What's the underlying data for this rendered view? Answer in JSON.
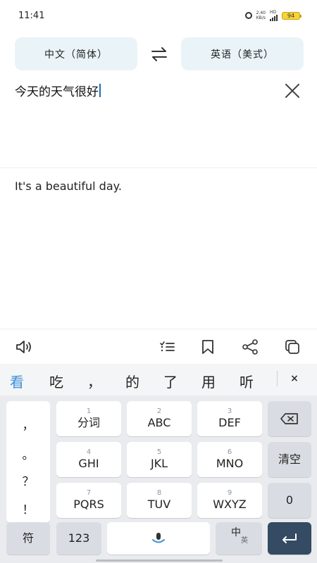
{
  "status": {
    "time": "11:41",
    "net_speed_value": "2.40",
    "net_speed_unit": "KB/s",
    "hd": "HD",
    "battery": "94"
  },
  "languages": {
    "source": "中文（简体）",
    "target": "英语（美式）"
  },
  "input": {
    "source_text": "今天的天气很好"
  },
  "result": {
    "translated_text": "It's a beautiful day."
  },
  "candidates": [
    "看",
    "吃",
    "，",
    "的",
    "了",
    "用",
    "听"
  ],
  "candidates_close": "×",
  "keyboard": {
    "punctuation": [
      "，",
      "。",
      "？",
      "！"
    ],
    "keys": [
      {
        "num": "1",
        "label": "分词"
      },
      {
        "num": "2",
        "label": "ABC"
      },
      {
        "num": "3",
        "label": "DEF"
      },
      {
        "num": "4",
        "label": "GHI"
      },
      {
        "num": "5",
        "label": "JKL"
      },
      {
        "num": "6",
        "label": "MNO"
      },
      {
        "num": "7",
        "label": "PQRS"
      },
      {
        "num": "8",
        "label": "TUV"
      },
      {
        "num": "9",
        "label": "WXYZ"
      }
    ],
    "clear_label": "清空",
    "zero_label": "0",
    "symbol_label": "符",
    "numeric_label": "123",
    "lang_switch_main": "中",
    "lang_switch_sub": "英"
  }
}
